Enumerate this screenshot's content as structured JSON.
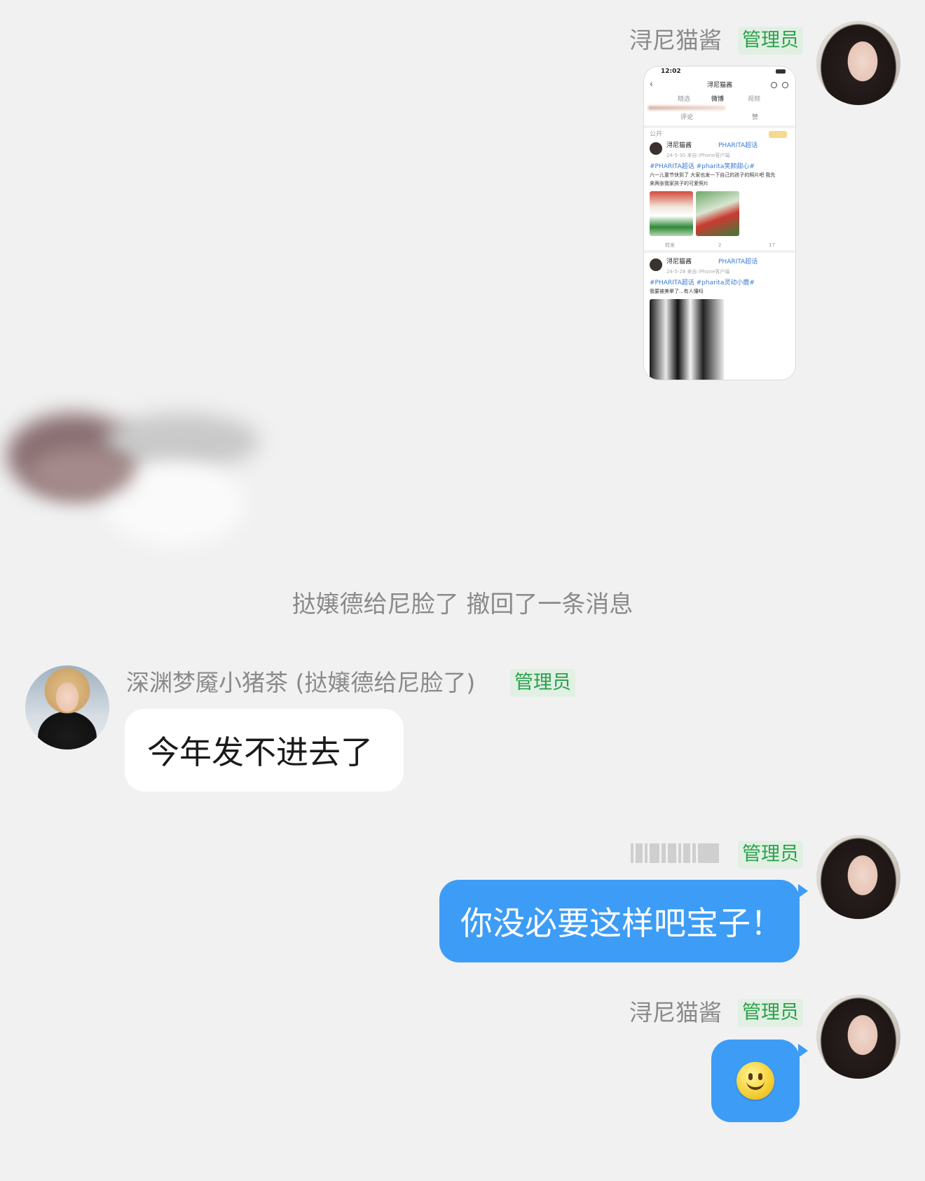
{
  "messages": {
    "m1": {
      "sender": "浔尼猫酱",
      "badge": "管理员"
    },
    "recall": {
      "text": "挞嬢德给尼脸了 撤回了一条消息"
    },
    "m2": {
      "sender": "深渊梦魇小猪茶 (挞嬢德给尼脸了)",
      "badge": "管理员",
      "text": "今年发不进去了"
    },
    "m3": {
      "badge": "管理员",
      "text": "你没必要这样吧宝子！"
    },
    "m4": {
      "sender": "浔尼猫酱",
      "badge": "管理员"
    }
  },
  "screenshot": {
    "time": "12:02",
    "title": "浔尼猫酱",
    "tabs": [
      "精选",
      "微博",
      "视频"
    ],
    "actions": [
      "评论",
      "赞"
    ],
    "section": "公开",
    "post1": {
      "author": "浔尼猫酱",
      "tag": "PHARITA超话",
      "meta": "24-5-30 来自 iPhone客户端",
      "topic": "#PHARITA超话 #pharita笑颜甜心#",
      "line1": "六一儿童节快到了 大家也发一下自己的孩子的照片吧 我先",
      "line2": "来两张我家孩子的可爱照片",
      "forward": "转发",
      "comments": "2",
      "likes": "17"
    },
    "post2": {
      "author": "浔尼猫酱",
      "tag": "PHARITA超话",
      "meta": "24-5-28 来自 iPhone客户端",
      "topic": "#PHARITA超话 #pharita灵动小鹿#",
      "line1": "我要被美晕了...有人懂吗"
    }
  },
  "colors": {
    "background": "#f1f1f1",
    "blue_bubble": "#3d9cf6",
    "admin_badge_bg": "#e2f0e4",
    "admin_badge_text": "#2aa14a"
  }
}
